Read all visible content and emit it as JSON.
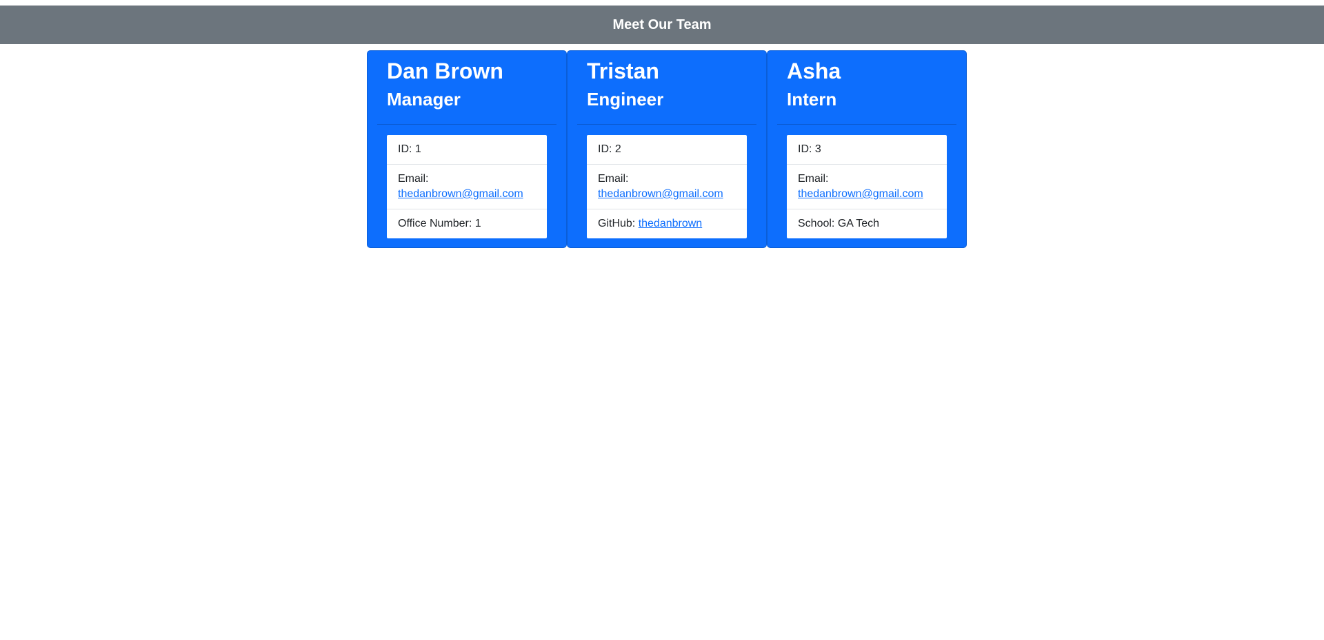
{
  "header": {
    "title": "Meet Our Team"
  },
  "colors": {
    "header_bg": "#6c757d",
    "card_bg": "#0d6efd",
    "link": "#0d6efd"
  },
  "team": [
    {
      "name": "Dan Brown",
      "role": "Manager",
      "id_label": "ID: 1",
      "email_label": "Email:",
      "email": "thedanbrown@gmail.com",
      "extra_label": "Office Number: 1"
    },
    {
      "name": "Tristan",
      "role": "Engineer",
      "id_label": "ID: 2",
      "email_label": "Email:",
      "email": "thedanbrown@gmail.com",
      "extra_label": "GitHub:",
      "extra_link": "thedanbrown"
    },
    {
      "name": "Asha",
      "role": "Intern",
      "id_label": "ID: 3",
      "email_label": "Email:",
      "email": "thedanbrown@gmail.com",
      "extra_label": "School: GA Tech"
    }
  ]
}
